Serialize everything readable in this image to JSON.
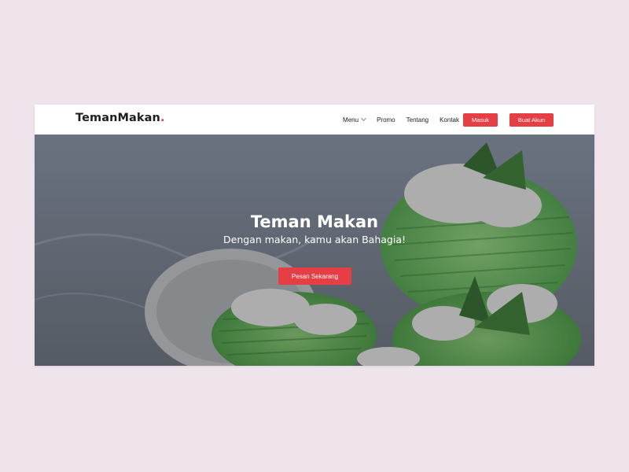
{
  "brand": {
    "name": "TemanMakan",
    "dot": ".",
    "accent_color": "#e53e45"
  },
  "nav": {
    "items": [
      {
        "label": "Menu",
        "has_dropdown": true,
        "icon": "chevron-down-icon"
      },
      {
        "label": "Promo"
      },
      {
        "label": "Tentang"
      },
      {
        "label": "Kontak"
      }
    ],
    "login_label": "Masuk",
    "signup_label": "Buat Akun"
  },
  "hero": {
    "title": "Teman Makan",
    "subtitle": "Dengan makan, kamu akan Bahagia!",
    "cta_label": "Pesan Sekarang",
    "background": "green-pandan-dessert-with-grated-coconut-photo"
  }
}
